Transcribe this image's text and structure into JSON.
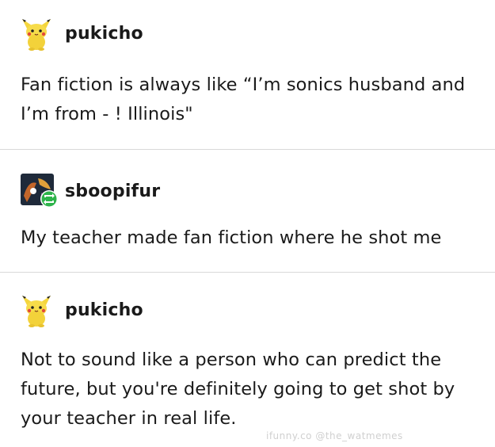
{
  "posts": [
    {
      "username": "pukicho",
      "avatar_icon": "pikachu-plush-icon",
      "text": "Fan fiction is always like “I’m sonics husband and I’m from  - ! Illinois\""
    },
    {
      "username": "sboopifur",
      "avatar_icon": "reblog-avatar-icon",
      "badge_icon": "reblog-icon",
      "badge_color": "#2db34a",
      "text": "My teacher made fan fiction where he shot me"
    },
    {
      "username": "pukicho",
      "avatar_icon": "pikachu-plush-icon",
      "text": "Not to sound like a person who can predict the future, but you're definitely going to get shot by your teacher in real life."
    }
  ],
  "watermark": "ifunny.co @the_watmemes"
}
